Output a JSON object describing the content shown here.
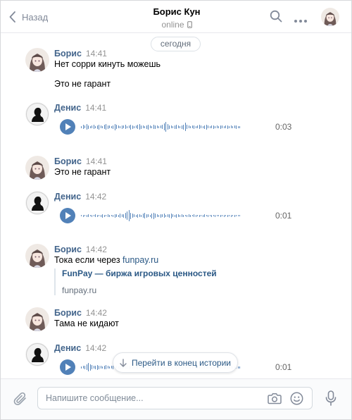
{
  "header": {
    "back_label": "Назад",
    "title": "Борис Кун",
    "status": "online"
  },
  "date_divider": "сегодня",
  "messages": [
    {
      "author": "Борис",
      "time": "14:41",
      "lines": [
        "Нет сорри кинуть можешь",
        "Это не гарант"
      ]
    },
    {
      "author": "Денис",
      "time": "14:41",
      "voice_duration": "0:03"
    },
    {
      "author": "Борис",
      "time": "14:41",
      "text": "Это не гарант"
    },
    {
      "author": "Денис",
      "time": "14:42",
      "voice_duration": "0:01"
    },
    {
      "author": "Борис",
      "time": "14:42",
      "text_prefix": "Тока если через",
      "link_text": "funpay.ru",
      "link_preview": {
        "title": "FunPay — биржа игровых ценностей",
        "domain": "funpay.ru"
      }
    },
    {
      "author": "Борис",
      "time": "14:42",
      "text": "Тама не кидают"
    },
    {
      "author": "Денис",
      "time": "14:42",
      "voice_duration": "0:01"
    }
  ],
  "voice_waveforms": [
    [
      3,
      6,
      4,
      8,
      5,
      3,
      4,
      6,
      3,
      5,
      7,
      4,
      3,
      6,
      8,
      5,
      4,
      3,
      5,
      9,
      6,
      4,
      3,
      5,
      4,
      6,
      3,
      4,
      7,
      5,
      3,
      4,
      6,
      8,
      5,
      4,
      3,
      5,
      7,
      4,
      3,
      6,
      5,
      4,
      3,
      4,
      6,
      10,
      14,
      8,
      5,
      4,
      3,
      5,
      6,
      4,
      3,
      5,
      7,
      12,
      6,
      4,
      3,
      4,
      5,
      3,
      4,
      6,
      4,
      3,
      5,
      7,
      4,
      3,
      4,
      5,
      3,
      4,
      3,
      5,
      4,
      3,
      4,
      5,
      3,
      4,
      3,
      4,
      5,
      3,
      3
    ],
    [
      2,
      3,
      2,
      3,
      4,
      2,
      3,
      2,
      4,
      3,
      2,
      3,
      5,
      3,
      2,
      4,
      3,
      2,
      3,
      5,
      4,
      3,
      6,
      4,
      5,
      8,
      12,
      16,
      9,
      6,
      4,
      3,
      5,
      4,
      3,
      6,
      8,
      5,
      4,
      3,
      7,
      9,
      6,
      4,
      3,
      5,
      4,
      6,
      3,
      4,
      5,
      7,
      4,
      3,
      5,
      4,
      3,
      4,
      3,
      2,
      3,
      4,
      3,
      2,
      4,
      3,
      2,
      3,
      2,
      3,
      4,
      2,
      3,
      2,
      3,
      2,
      3,
      2,
      2,
      3,
      2,
      3,
      2,
      3,
      2,
      3,
      2,
      3,
      2,
      2,
      2
    ],
    [
      3,
      4,
      5,
      8,
      12,
      9,
      6,
      4,
      5,
      7,
      5,
      4,
      3,
      5,
      6,
      4,
      3,
      4,
      5,
      3,
      4,
      3,
      5,
      4,
      3,
      4,
      6,
      5,
      3,
      4,
      3,
      4,
      5,
      3,
      4,
      3,
      4,
      3,
      5,
      4,
      3,
      4,
      3,
      5,
      4,
      3,
      3,
      4,
      3,
      4,
      3,
      4,
      3,
      4,
      5,
      4,
      3,
      4,
      3,
      4,
      3,
      4,
      3,
      4,
      3,
      4,
      3,
      3,
      4,
      3,
      4,
      3,
      3,
      4,
      3,
      3,
      4,
      3,
      3,
      4,
      3,
      3,
      4,
      3,
      3,
      4,
      3,
      3,
      3,
      3,
      3
    ]
  ],
  "jump_label": "Перейти в конец истории",
  "composer": {
    "placeholder": "Напишите сообщение..."
  }
}
